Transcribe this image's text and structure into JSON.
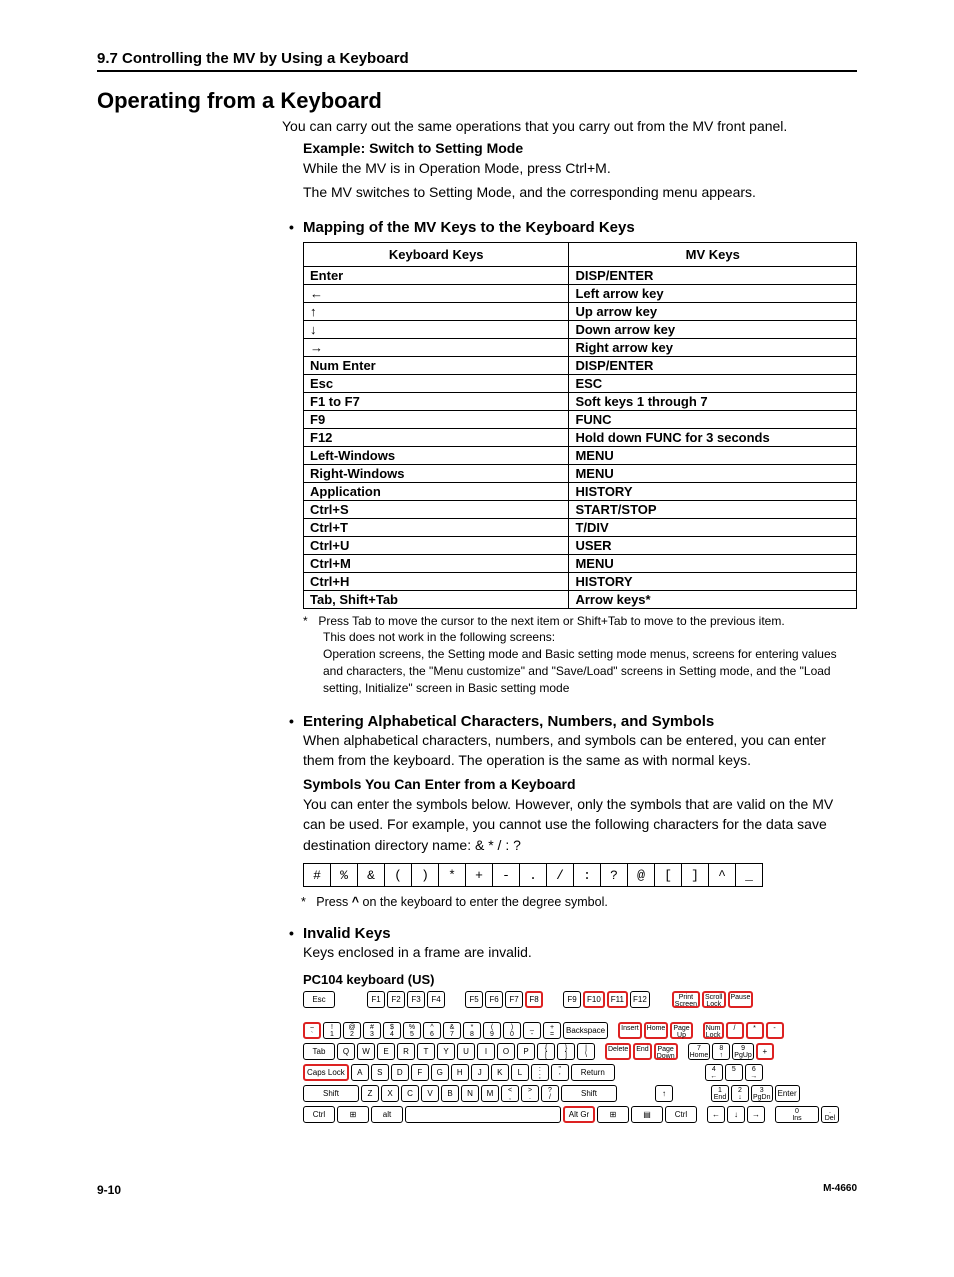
{
  "header": {
    "section": "9.7  Controlling the MV by Using a Keyboard"
  },
  "title": "Operating from a Keyboard",
  "intro": "You can carry out the same operations that you carry out from the MV front panel.",
  "example": {
    "heading": "Example: Switch to Setting Mode",
    "line1": "While the MV is in Operation Mode, press Ctrl+M.",
    "line2": "The MV switches to Setting Mode, and the corresponding menu appears."
  },
  "mapping": {
    "heading": "Mapping of the MV Keys to the Keyboard Keys",
    "col1": "Keyboard Keys",
    "col2": "MV Keys",
    "rows": [
      {
        "k": "Enter",
        "m": "DISP/ENTER"
      },
      {
        "k": "←",
        "m": "Left arrow key"
      },
      {
        "k": "↑",
        "m": "Up arrow key"
      },
      {
        "k": "↓",
        "m": "Down arrow key"
      },
      {
        "k": "→",
        "m": "Right arrow key"
      },
      {
        "k": "Num Enter",
        "m": "DISP/ENTER"
      },
      {
        "k": "Esc",
        "m": "ESC"
      },
      {
        "k": "F1 to F7",
        "m": "Soft keys 1 through 7"
      },
      {
        "k": "F9",
        "m": "FUNC"
      },
      {
        "k": "F12",
        "m": "Hold down FUNC for 3 seconds"
      },
      {
        "k": "Left-Windows",
        "m": "MENU"
      },
      {
        "k": "Right-Windows",
        "m": "MENU"
      },
      {
        "k": "Application",
        "m": "HISTORY"
      },
      {
        "k": "Ctrl+S",
        "m": "START/STOP"
      },
      {
        "k": "Ctrl+T",
        "m": "T/DIV"
      },
      {
        "k": "Ctrl+U",
        "m": "USER"
      },
      {
        "k": "Ctrl+M",
        "m": "MENU"
      },
      {
        "k": "Ctrl+H",
        "m": "HISTORY"
      },
      {
        "k": "Tab, Shift+Tab",
        "m": "Arrow keys*"
      }
    ],
    "footnote_star": "*",
    "footnote1": "Press Tab to move the cursor to the next item or Shift+Tab to move to the previous item.",
    "footnote2": "This does not work in the following screens:",
    "footnote3": "Operation screens, the Setting mode and Basic setting mode menus, screens for entering values and characters, the \"Menu customize\" and \"Save/Load\" screens in Setting mode, and the \"Load setting, Initialize\" screen in Basic setting mode"
  },
  "entering": {
    "heading": "Entering Alphabetical Characters, Numbers, and Symbols",
    "body": "When alphabetical characters, numbers, and symbols can be entered, you can enter them from the keyboard. The operation is the same as with normal keys.",
    "symbols_heading": "Symbols You Can Enter from a Keyboard",
    "symbols_body": "You can enter the symbols below. However, only the symbols that are valid on the MV can be used. For example, you cannot use the following characters for the data save destination directory name: & * / : ?",
    "symbols": [
      "#",
      "%",
      "&",
      "(",
      ")",
      "*",
      "+",
      "-",
      ".",
      "/",
      ":",
      "?",
      "@",
      "[",
      "]",
      "^",
      "_"
    ],
    "sym_note_star": "*",
    "sym_note": "Press ^ on the keyboard to enter the degree symbol."
  },
  "invalid": {
    "heading": "Invalid Keys",
    "body": "Keys enclosed in a frame are invalid.",
    "kbd_label": "PC104 keyboard (US)"
  },
  "keyboard": {
    "fn_row": {
      "esc": "Esc",
      "g1": [
        "F1",
        "F2",
        "F3",
        "F4"
      ],
      "g2": [
        "F5",
        "F6",
        "F7",
        "F8"
      ],
      "g3": [
        "F9",
        "F10",
        "F11",
        "F12"
      ],
      "sys": [
        "Print Screen",
        "Scroll Lock",
        "Pause"
      ]
    },
    "row1": {
      "keys": [
        {
          "t": "~",
          "b": "`",
          "inv": true
        },
        {
          "t": "!",
          "b": "1"
        },
        {
          "t": "@",
          "b": "2"
        },
        {
          "t": "#",
          "b": "3"
        },
        {
          "t": "$",
          "b": "4"
        },
        {
          "t": "%",
          "b": "5"
        },
        {
          "t": "^",
          "b": "6"
        },
        {
          "t": "&",
          "b": "7"
        },
        {
          "t": "*",
          "b": "8"
        },
        {
          "t": "(",
          "b": "9"
        },
        {
          "t": ")",
          "b": "0"
        },
        {
          "t": "_",
          "b": "-"
        },
        {
          "t": "+",
          "b": "="
        }
      ],
      "backspace": "Backspace",
      "nav": [
        "Insert",
        "Home",
        "Page Up"
      ],
      "np": [
        "Num Lock",
        "/",
        "*",
        "-"
      ]
    },
    "row2": {
      "tab": "Tab",
      "keys": [
        "Q",
        "W",
        "E",
        "R",
        "T",
        "Y",
        "U",
        "I",
        "O",
        "P"
      ],
      "br": [
        {
          "t": "{",
          "b": "["
        },
        {
          "t": "}",
          "b": "]"
        },
        {
          "t": "|",
          "b": "\\"
        }
      ],
      "nav": [
        "Delete",
        "End",
        "Page Down"
      ],
      "np": [
        {
          "t": "7",
          "b": "Home"
        },
        {
          "t": "8",
          "b": "↑"
        },
        {
          "t": "9",
          "b": "PgUp"
        }
      ],
      "plus": "+"
    },
    "row3": {
      "caps": "Caps Lock",
      "keys": [
        "A",
        "S",
        "D",
        "F",
        "G",
        "H",
        "J",
        "K",
        "L"
      ],
      "p": [
        {
          "t": ":",
          "b": ";"
        },
        {
          "t": "\"",
          "b": "'"
        }
      ],
      "enter": "Return",
      "np": [
        {
          "t": "4",
          "b": "←"
        },
        {
          "t": "5",
          "b": ""
        },
        {
          "t": "6",
          "b": "→"
        }
      ]
    },
    "row4": {
      "shiftL": "Shift",
      "keys": [
        "Z",
        "X",
        "C",
        "V",
        "B",
        "N",
        "M"
      ],
      "p": [
        {
          "t": "<",
          "b": ","
        },
        {
          "t": ">",
          "b": "."
        },
        {
          "t": "?",
          "b": "/"
        }
      ],
      "shiftR": "Shift",
      "up": "↑",
      "np": [
        {
          "t": "1",
          "b": "End"
        },
        {
          "t": "2",
          "b": "↓"
        },
        {
          "t": "3",
          "b": "PgDn"
        }
      ],
      "enter": "Enter"
    },
    "row5": {
      "keys": [
        "Ctrl",
        "⊞",
        "alt"
      ],
      "space": "",
      "right": [
        "Alt Gr",
        "⊞",
        "▤",
        "Ctrl"
      ],
      "arrows": [
        "←",
        "↓",
        "→"
      ],
      "np": [
        {
          "t": "0",
          "b": "Ins"
        },
        {
          "t": ".",
          "b": "Del"
        }
      ]
    },
    "invalid_fn": [
      "F8",
      "F10",
      "F11"
    ],
    "invalid_sys": [
      "Print Screen",
      "Scroll Lock",
      "Pause"
    ],
    "invalid_nav1": [
      "Insert",
      "Home",
      "Page Up"
    ],
    "invalid_nav2": [
      "Delete",
      "End",
      "Page Down"
    ],
    "invalid_np_top": [
      "Num Lock",
      "/",
      "*",
      "-"
    ],
    "invalid_row3_caps": true,
    "invalid_row5_altgr": true
  },
  "footer": {
    "page": "9-10",
    "code": "M-4660"
  }
}
